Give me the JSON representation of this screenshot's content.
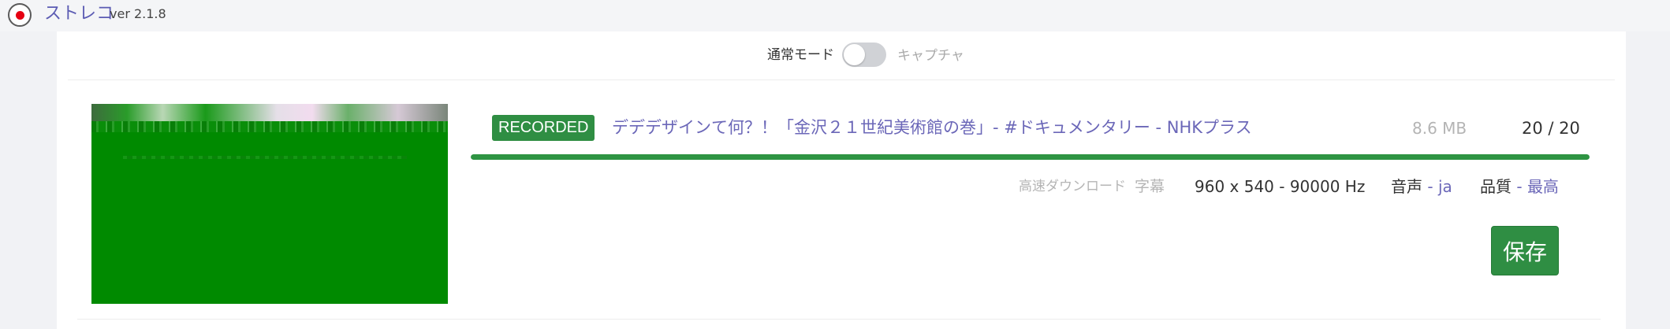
{
  "app": {
    "name": "ストレコ",
    "version": "ver 2.1.8"
  },
  "mode": {
    "normal_label": "通常モード",
    "capture_label": "キャプチャ",
    "capture_enabled": false
  },
  "item": {
    "status_badge": "RECORDED",
    "title": "デデデザインて何？！「金沢２１世紀美術館の巻」- #ドキュメンタリー - NHKプラス",
    "file_size": "8.6 MB",
    "segments": "20 / 20",
    "progress": 1.0,
    "meta": {
      "fast_download": "高速ダウンロード",
      "subtitles": "字幕",
      "resolution": "960 x 540 - 90000 Hz",
      "audio_label": "音声",
      "audio_separator": " - ",
      "audio_value": "ja",
      "quality_label": "品質",
      "quality_separator": " - ",
      "quality_value": "最高"
    },
    "save_label": "保存"
  },
  "colors": {
    "accent_green": "#2f8e43",
    "link_purple": "#6b67b8",
    "thumbnail_green": "#008a00"
  }
}
